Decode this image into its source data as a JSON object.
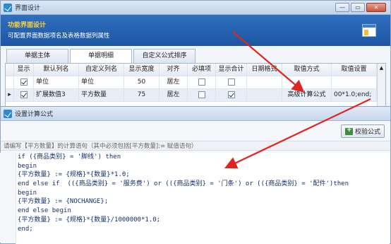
{
  "main_window": {
    "title": "界面设计",
    "banner_title": "功能界面设计",
    "banner_subtitle": "可配置界面数据项名及表格数据列属性",
    "controls": {
      "minimize": "—",
      "maximize": "▭",
      "close": "✕"
    }
  },
  "tabs": [
    {
      "label": "单据主体",
      "active": false
    },
    {
      "label": "单据明细",
      "active": true
    },
    {
      "label": "自定义公式排序",
      "active": false
    }
  ],
  "grid": {
    "columns": [
      "显示",
      "默认列名",
      "自定义列名",
      "显示宽度",
      "对齐",
      "必填项",
      "显示合计",
      "日期格式",
      "取值方式",
      "取值设置"
    ],
    "rows": [
      {
        "marker": "",
        "show": true,
        "default_name": "单位",
        "custom_name": "单位",
        "width": "50",
        "align": "居左",
        "required": false,
        "total": false,
        "date_format": "",
        "value_mode": "",
        "value_setting": ""
      },
      {
        "marker": "▸",
        "show": true,
        "default_name": "扩展数值3",
        "custom_name": "平方数量",
        "width": "75",
        "align": "居左",
        "required": false,
        "total": true,
        "date_format": "",
        "value_mode": "高级计算公式",
        "value_setting": "00*1.0;end;"
      }
    ]
  },
  "dialog": {
    "title": "设置计算公式",
    "verify_button": "校验公式",
    "hint": "请编写【平方数量】的计算语句（其中必须包括[平方数量]:= 赋值语句）",
    "code_lines": [
      "if ({商品类别} = '脚线') then",
      "begin",
      "{平方数量} := {规格}*{数量}*1.0;",
      "end else if  (({商品类别} = '服务费') or (({商品类别} = '门条') or (({商品类别} = '配件')then",
      "begin",
      "{平方数量} := {NOCHANGE};",
      "end else begin",
      "{平方数量} := {规格}*{数量}/1000000*1.0;",
      "end;"
    ]
  },
  "colors": {
    "annotation_arrow": "#e0251f",
    "banner": "#1d56a3",
    "banner_title": "#ffd23c"
  }
}
